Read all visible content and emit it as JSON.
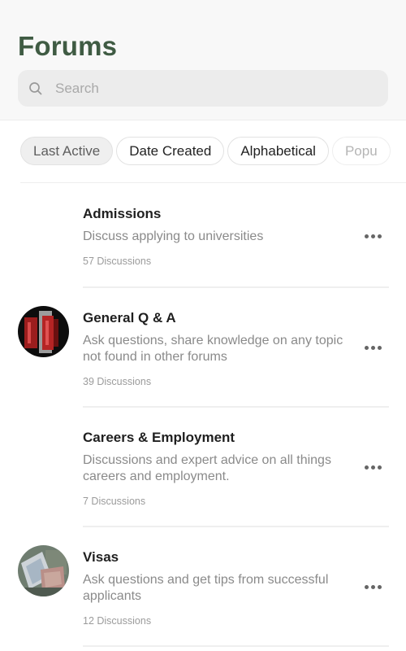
{
  "header": {
    "title": "Forums",
    "search": {
      "placeholder": "Search",
      "value": "",
      "icon": "search-icon"
    }
  },
  "sort_chips": [
    {
      "label": "Last Active",
      "selected": true
    },
    {
      "label": "Date Created",
      "selected": false
    },
    {
      "label": "Alphabetical",
      "selected": false
    },
    {
      "label": "Popu",
      "selected": false
    }
  ],
  "forums": [
    {
      "name": "Admissions",
      "description": "Discuss applying to universities",
      "count": "57 Discussions",
      "avatar": null,
      "menu_icon": "more-horizontal-icon"
    },
    {
      "name": "General Q & A",
      "description": "Ask questions, share knowledge on any topic not found in other forums",
      "count": "39 Discussions",
      "avatar": "dark-red-graphic-image",
      "menu_icon": "more-horizontal-icon"
    },
    {
      "name": "Careers & Employment",
      "description": "Discussions and expert advice on all things careers and employment.",
      "count": "7 Discussions",
      "avatar": null,
      "menu_icon": "more-horizontal-icon"
    },
    {
      "name": "Visas",
      "description": "Ask questions and get tips from successful applicants",
      "count": "12 Discussions",
      "avatar": "passport-image",
      "menu_icon": "more-horizontal-icon"
    }
  ],
  "colors": {
    "title": "#3f5b43",
    "header_bg": "#f8f8f8",
    "search_bg": "#ececec",
    "chip_active_bg": "#efefef",
    "text_primary": "#1f1f1f",
    "text_secondary": "#8a8a8a"
  }
}
